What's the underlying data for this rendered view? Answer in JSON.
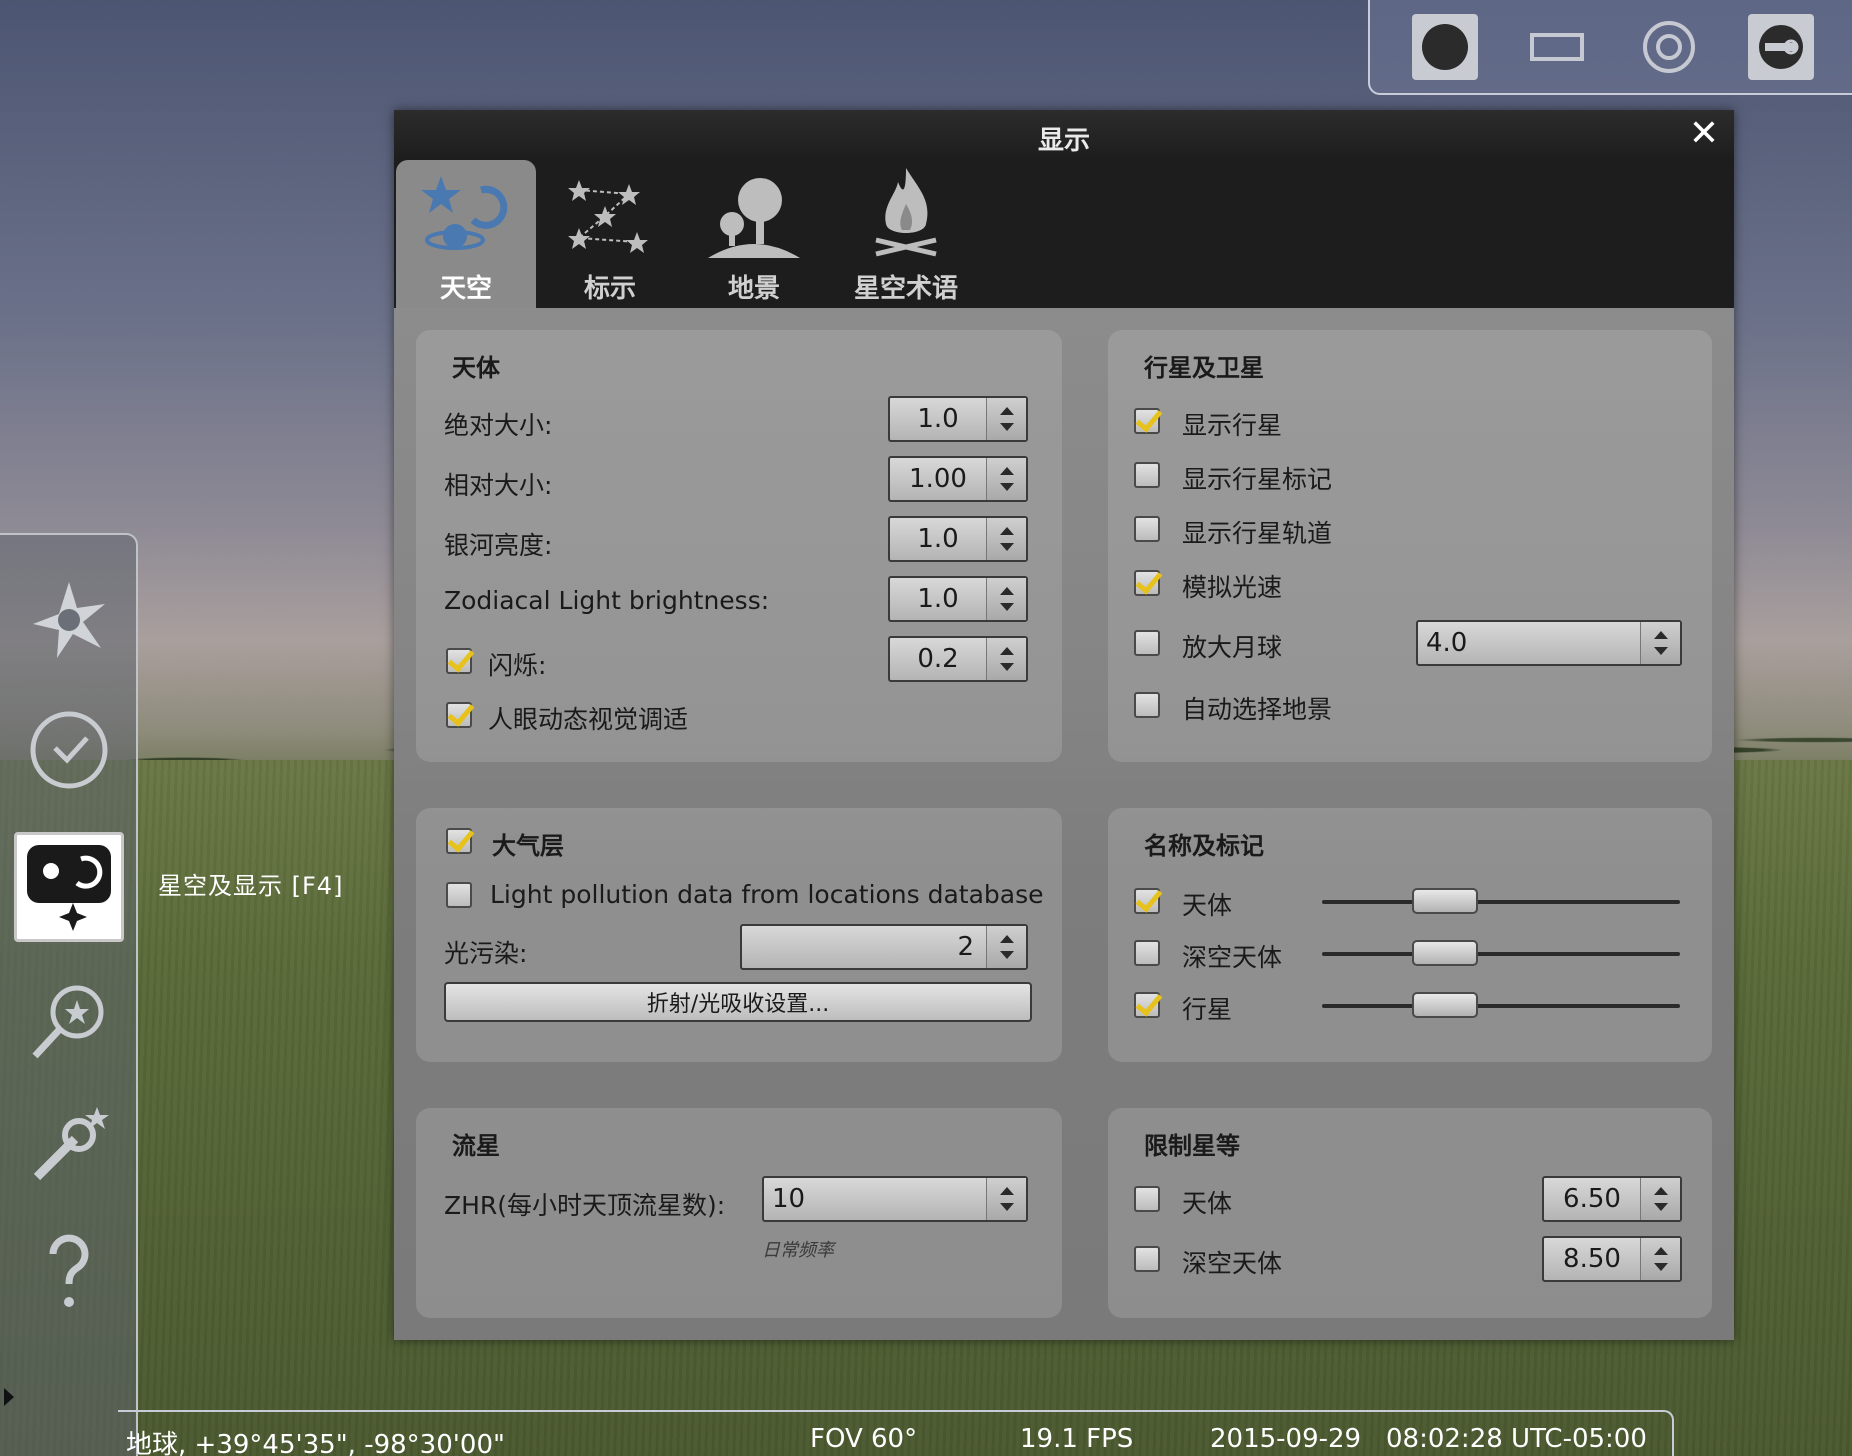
{
  "window": {
    "title": "显示",
    "close_label": "✕"
  },
  "tabs": [
    {
      "label": "天空",
      "icon": "sky-icon",
      "active": true
    },
    {
      "label": "标示",
      "icon": "constellation-icon",
      "active": false
    },
    {
      "label": "地景",
      "icon": "landscape-icon",
      "active": false
    },
    {
      "label": "星空术语",
      "icon": "starlore-icon",
      "active": false
    }
  ],
  "stars_panel": {
    "title": "天体",
    "absolute_scale": {
      "label": "绝对大小:",
      "value": "1.0"
    },
    "relative_scale": {
      "label": "相对大小:",
      "value": "1.00"
    },
    "milky_way": {
      "label": "银河亮度:",
      "value": "1.0"
    },
    "zodiacal": {
      "label": "Zodiacal Light brightness:",
      "value": "1.0"
    },
    "twinkle": {
      "label": "闪烁:",
      "value": "0.2",
      "checked": true
    },
    "eye_adapt": {
      "label": "人眼动态视觉调适",
      "checked": true
    }
  },
  "planets_panel": {
    "title": "行星及卫星",
    "show_planets": {
      "label": "显示行星",
      "checked": true
    },
    "show_markers": {
      "label": "显示行星标记",
      "checked": false
    },
    "show_orbits": {
      "label": "显示行星轨道",
      "checked": false
    },
    "light_speed": {
      "label": "模拟光速",
      "checked": true
    },
    "scale_moon": {
      "label": "放大月球",
      "checked": false,
      "value": "4.0"
    },
    "auto_landscape": {
      "label": "自动选择地景",
      "checked": false
    }
  },
  "atmosphere_panel": {
    "title": "大气层",
    "checked": true,
    "light_pollution_db": {
      "label": "Light pollution data from locations database",
      "checked": false
    },
    "light_pollution": {
      "label": "光污染:",
      "value": "2"
    },
    "refraction_button": "折射/光吸收设置..."
  },
  "labels_panel": {
    "title": "名称及标记",
    "items": [
      {
        "label": "天体",
        "checked": true,
        "level": 0.25
      },
      {
        "label": "深空天体",
        "checked": false,
        "level": 0.25
      },
      {
        "label": "行星",
        "checked": true,
        "level": 0.25
      }
    ]
  },
  "meteors_panel": {
    "title": "流星",
    "zhr": {
      "label": "ZHR(每小时天顶流星数):",
      "value": "10"
    },
    "hint": "日常频率"
  },
  "limit_panel": {
    "title": "限制星等",
    "stars": {
      "label": "天体",
      "checked": false,
      "value": "6.50"
    },
    "dso": {
      "label": "深空天体",
      "checked": false,
      "value": "8.50"
    }
  },
  "sidebar": {
    "tooltip": "星空及显示  [F4]",
    "items": [
      "location-icon",
      "datetime-icon",
      "sky-display-icon",
      "search-icon",
      "configuration-icon",
      "help-icon"
    ]
  },
  "statusbar": {
    "location": "地球, +39°45'35\", -98°30'00\"",
    "fov": "FOV 60°",
    "fps": "19.1 FPS",
    "date": "2015-09-29",
    "time": "08:02:28 UTC-05:00"
  },
  "topbar": [
    "fullscreen-circle-icon",
    "window-rect-icon",
    "target-icon",
    "plugin-icon"
  ],
  "colors": {
    "accent_check": "#e6c21a",
    "panel_bg": "#8a8a8a",
    "title_bg": "#1d1d1d"
  }
}
